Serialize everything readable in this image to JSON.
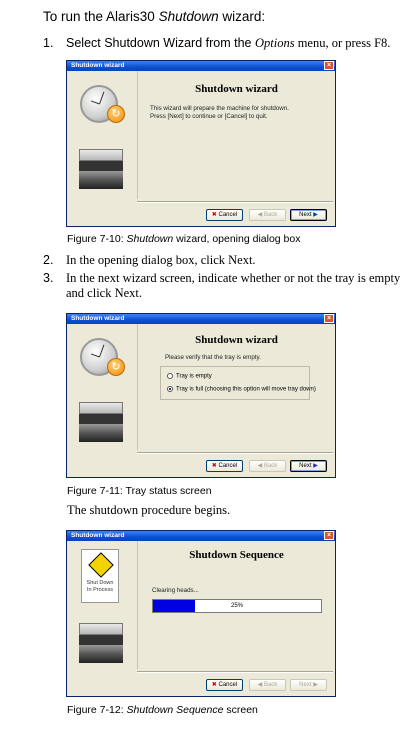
{
  "intro": {
    "prefix": "To run the Alaris30 ",
    "emph": "Shutdown",
    "suffix": " wizard:"
  },
  "steps": [
    {
      "num": "1.",
      "text_a": "Select Shutdown Wizard from the ",
      "text_em": "Options",
      "text_b": " menu, or press F8."
    },
    {
      "num": "2.",
      "text": "In the opening dialog box, click Next."
    },
    {
      "num": "3.",
      "line1": "In the next wizard screen, indicate whether or not the tray is empty",
      "line2": "and click Next."
    }
  ],
  "paragraph": "The shutdown procedure begins.",
  "buttons": {
    "cancel": "Cancel",
    "back": "Back",
    "next": "Next"
  },
  "figures": [
    {
      "window_title": "Shutdown wizard",
      "heading": "Shutdown wizard",
      "body_line1": "This wizard will prepare the machine for shutdown.",
      "body_line2": "Press [Next] to continue or [Cancel] to quit.",
      "caption_prefix": "Figure 7-10: ",
      "caption_em": "Shutdown",
      "caption_suffix": " wizard, opening dialog box"
    },
    {
      "window_title": "Shutdown wizard",
      "heading": "Shutdown wizard",
      "prompt": "Please verify that the tray is empty.",
      "option_empty": "Tray is empty",
      "option_full": "Tray is full (choosing this option will move tray down)",
      "selected": "full",
      "caption": "Figure 7-11: Tray status screen"
    },
    {
      "window_title": "Shutdown wizard",
      "heading": "Shutdown Sequence",
      "doc_label_line1": "Shut Down",
      "doc_label_line2": "In Process",
      "status": "Clearing heads...",
      "progress_percent": 25,
      "progress_label": "25%",
      "caption_prefix": "Figure 7-12: ",
      "caption_em": "Shutdown Sequence",
      "caption_suffix": " screen"
    }
  ],
  "colors": {
    "titlebar": "#0a4fd4",
    "dialog_bg": "#ece9d8",
    "progress_fill": "#0000e0",
    "close_button": "#d9532b"
  },
  "icons": [
    "clock-icon",
    "refresh-icon",
    "printer-icon",
    "warning-icon",
    "close-icon",
    "cancel-icon",
    "back-arrow-icon",
    "next-arrow-icon"
  ]
}
